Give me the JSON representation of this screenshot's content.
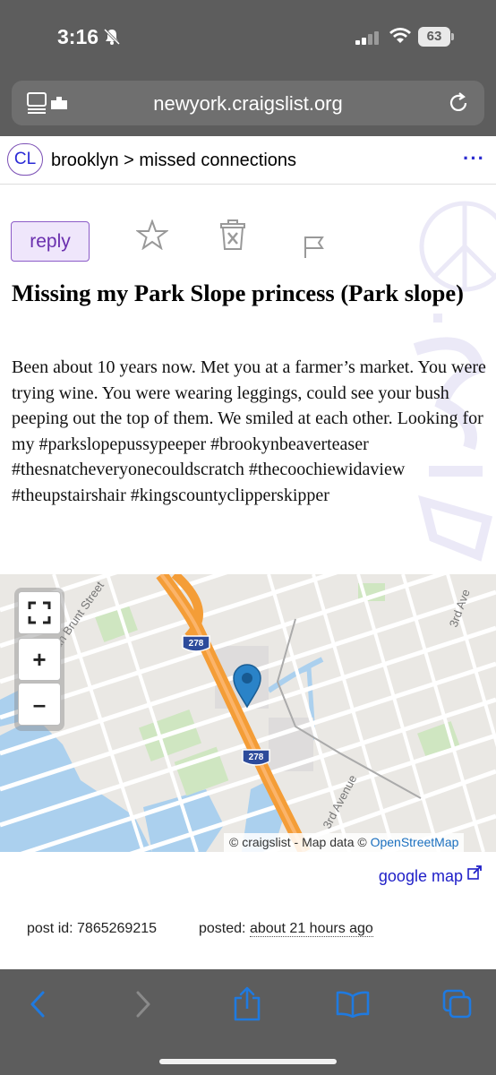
{
  "status": {
    "time": "3:16",
    "battery": "63"
  },
  "browser": {
    "url": "newyork.craigslist.org"
  },
  "header": {
    "logo": "CL",
    "breadcrumb_area": "brooklyn",
    "breadcrumb_sep": " > ",
    "breadcrumb_section": "missed connections",
    "menu": "···"
  },
  "post": {
    "reply_label": "reply",
    "title": "Missing my Park Slope princess (Park slope)",
    "body": "Been about 10 years now. Met you at a farmer’s market. You were trying wine. You were wearing leggings, could see your bush peeping out the top of them. We smiled at each other. Looking for my #parkslopepussypeeper #brookynbeaverteaser #thesnatcheveryonecouldscratch #thecoochiewidaview #theupstairshair #kingscountyclipperskipper"
  },
  "map": {
    "labels": {
      "street1": "Van Brunt Street",
      "street2": "3rd Ave",
      "street3": "3rd Avenue",
      "highway": "278"
    },
    "attrib_prefix": "© craigslist - Map data © ",
    "attrib_link": "OpenStreetMap",
    "controls": {
      "fullscreen": "⛶",
      "zoom_in": "+",
      "zoom_out": "–"
    }
  },
  "google_map_label": "google map",
  "meta": {
    "post_id_label": "post id: 7865269215",
    "posted_label": "posted: ",
    "posted_time": "about 21 hours ago"
  },
  "colors": {
    "chrome": "#5d5d5d",
    "link": "#2020c8",
    "accent_purple": "#8c5cc8",
    "ios_blue": "#1f7ae0"
  }
}
